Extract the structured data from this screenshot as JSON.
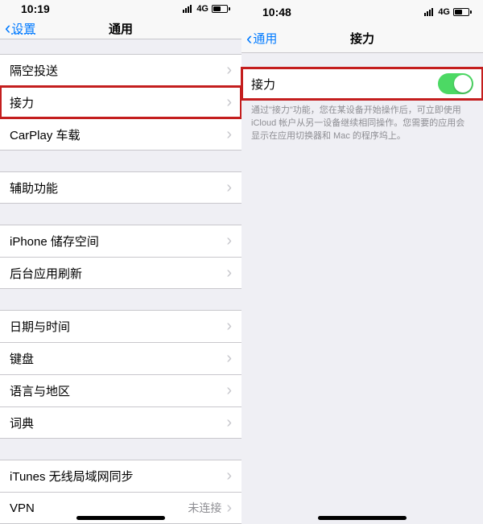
{
  "left": {
    "status": {
      "time": "10:19",
      "network": "4G"
    },
    "nav": {
      "back_label": "设置",
      "title": "通用"
    },
    "groups": [
      {
        "items": [
          {
            "label": "隔空投送",
            "name": "airdrop",
            "highlight": false
          },
          {
            "label": "接力",
            "name": "handoff",
            "highlight": true
          },
          {
            "label": "CarPlay 车载",
            "name": "carplay",
            "highlight": false
          }
        ]
      },
      {
        "items": [
          {
            "label": "辅助功能",
            "name": "accessibility",
            "highlight": false
          }
        ]
      },
      {
        "items": [
          {
            "label": "iPhone 储存空间",
            "name": "iphone-storage",
            "highlight": false
          },
          {
            "label": "后台应用刷新",
            "name": "background-app-refresh",
            "highlight": false
          }
        ]
      },
      {
        "items": [
          {
            "label": "日期与时间",
            "name": "date-time",
            "highlight": false
          },
          {
            "label": "键盘",
            "name": "keyboard",
            "highlight": false
          },
          {
            "label": "语言与地区",
            "name": "language-region",
            "highlight": false
          },
          {
            "label": "词典",
            "name": "dictionary",
            "highlight": false
          }
        ]
      },
      {
        "items": [
          {
            "label": "iTunes 无线局域网同步",
            "name": "itunes-wifi-sync",
            "highlight": false
          },
          {
            "label": "VPN",
            "name": "vpn",
            "detail": "未连接",
            "highlight": false
          }
        ]
      }
    ]
  },
  "right": {
    "status": {
      "time": "10:48",
      "network": "4G"
    },
    "nav": {
      "back_label": "通用",
      "title": "接力"
    },
    "toggle": {
      "label": "接力",
      "on": true
    },
    "footer": "通过\"接力\"功能，您在某设备开始操作后，可立即使用 iCloud 帐户从另一设备继续相同操作。您需要的应用会显示在应用切换器和 Mac 的程序坞上。"
  }
}
